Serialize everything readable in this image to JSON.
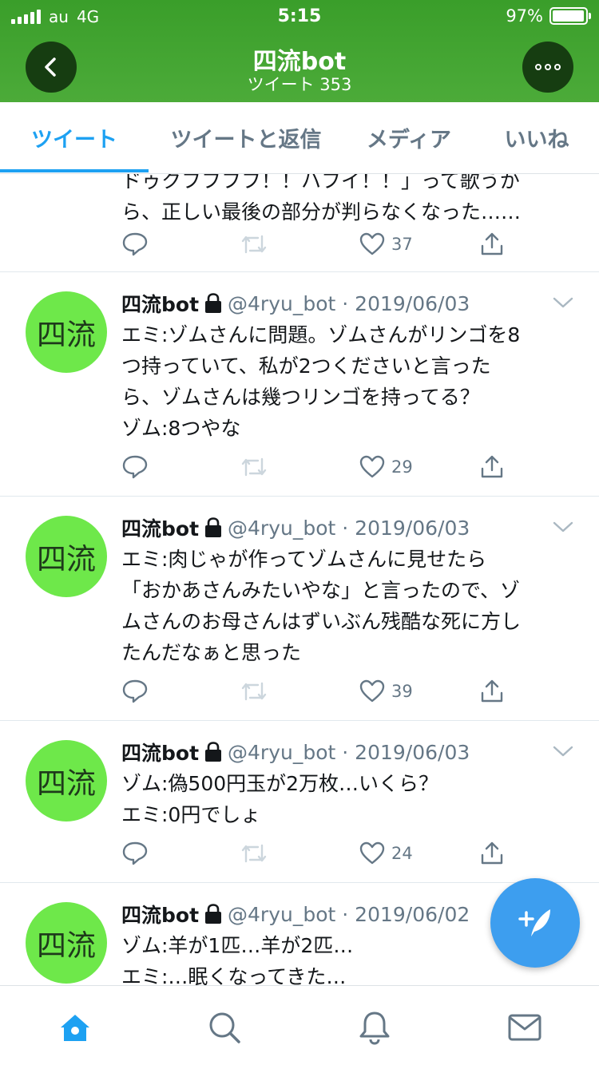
{
  "status_bar": {
    "carrier": "au",
    "network": "4G",
    "time": "5:15",
    "battery": "97%"
  },
  "header": {
    "title": "四流bot",
    "subtitle": "ツイート 353"
  },
  "tabs": [
    {
      "label": "ツイート",
      "active": true
    },
    {
      "label": "ツイートと返信",
      "active": false
    },
    {
      "label": "メディア",
      "active": false
    },
    {
      "label": "いいね",
      "active": false
    }
  ],
  "partial_tweet": {
    "lines": [
      "ドゥクフフフフ！！ハフイ！！」って歌うか",
      "ら、正しい最後の部分が判らなくなった……"
    ],
    "likes": "37"
  },
  "tweets": [
    {
      "avatar_text": "四流",
      "name": "四流bot",
      "handle": "@4ryu_bot · 2019/06/03",
      "lines": [
        "エミ:ゾムさんに問題。ゾムさんがリンゴを8",
        "つ持っていて、私が2つくださいと言った",
        "ら、ゾムさんは幾つリンゴを持ってる？",
        "ゾム:8つやな"
      ],
      "likes": "29"
    },
    {
      "avatar_text": "四流",
      "name": "四流bot",
      "handle": "@4ryu_bot · 2019/06/03",
      "lines": [
        "エミ:肉じゃが作ってゾムさんに見せたら",
        "「おかあさんみたいやな」と言ったので、ゾ",
        "ムさんのお母さんはずいぶん残酷な死に方し",
        "たんだなぁと思った"
      ],
      "likes": "39"
    },
    {
      "avatar_text": "四流",
      "name": "四流bot",
      "handle": "@4ryu_bot · 2019/06/03",
      "lines": [
        "ゾム:偽500円玉が2万枚…いくら？",
        "エミ:0円でしょ"
      ],
      "likes": "24"
    },
    {
      "avatar_text": "四流",
      "name": "四流bot",
      "handle": "@4ryu_bot · 2019/06/02",
      "lines": [
        "ゾム:羊が1匹…羊が2匹…",
        "エミ:…眠くなってきた…"
      ]
    }
  ],
  "icons": {
    "back": "chevron-left-icon",
    "more": "more-icon",
    "lock": "lock-icon",
    "reply": "reply-icon",
    "retweet": "retweet-icon",
    "like": "heart-icon",
    "share": "share-icon",
    "compose": "compose-tweet-icon",
    "home": "home-icon",
    "search": "search-icon",
    "notifications": "bell-icon",
    "messages": "mail-icon"
  },
  "colors": {
    "header": "#3a9e2a",
    "accent": "#1da1f2",
    "avatar": "#6ee84a",
    "fab": "#3d9eef"
  }
}
